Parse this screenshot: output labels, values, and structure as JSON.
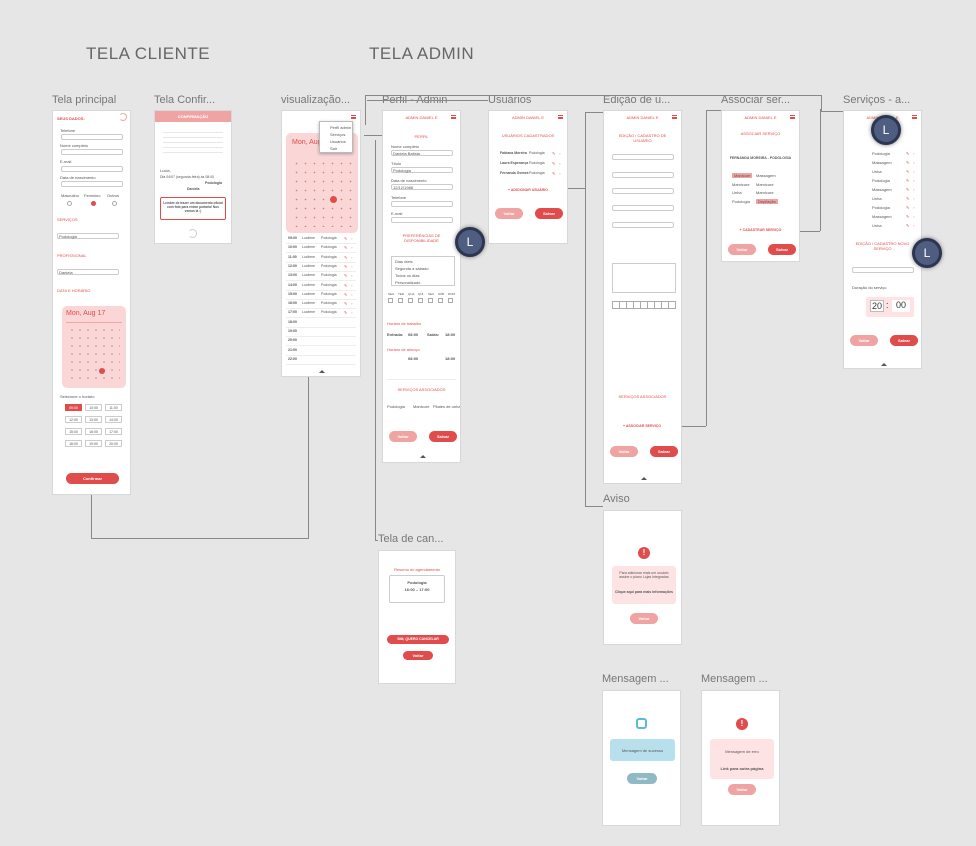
{
  "sections": {
    "client": "TELA CLIENTE",
    "admin": "TELA ADMIN"
  },
  "frames": {
    "principal": "Tela principal",
    "confirm": "Tela Confir...",
    "visual": "visualização...",
    "perfil": "Perfil - Admin",
    "usuarios": "Usuários",
    "edicao": "Edição de u...",
    "associar": "Associar ser...",
    "servicos": "Serviços - a...",
    "cancel": "Tela de can...",
    "aviso": "Aviso",
    "msg1": "Mensagem ...",
    "msg2": "Mensagem ..."
  },
  "avatar_letter": "L",
  "principal": {
    "header": "SEUS DADOS:",
    "telefone": "Telefone",
    "nome": "Nome completo",
    "email": "E-mail",
    "nascimento": "Data de nascimento",
    "genero": [
      "Masculino",
      "Feminino",
      "Outros"
    ],
    "servicos": "SERVIÇOS",
    "servico_sel": "Podologia",
    "profissional": "PROFISSIONAL",
    "prof_sel": "Daniela",
    "data_hora": "DATA E HORÁRIO",
    "cal_title": "Mon, Aug 17",
    "confirmar": "Confirmar",
    "times": [
      "09:00",
      "10:00",
      "11:00",
      "12:00",
      "13:00",
      "14:00",
      "15:00",
      "16:00",
      "17:00",
      "18:00",
      "19:00",
      "20:00"
    ]
  },
  "confirm": {
    "header": "CONFIRMAÇÃO",
    "text": "Lúcia,",
    "date": "Dia 04/07 (segunda-feira) às 08:00",
    "service": "Podologia",
    "prof": "Daniela",
    "note": "Lembre de trazer um documento oficial com foto para entrar portaria! Nos vemos lá :)"
  },
  "visual": {
    "month": "Mon, Aug 17",
    "agenda": [
      {
        "time": "09:00",
        "name": "Lucilene",
        "svc": "Podologia"
      },
      {
        "time": "10:00",
        "name": "Lucilene",
        "svc": "Podologia"
      },
      {
        "time": "11:00",
        "name": "Lucilene",
        "svc": "Podologia"
      },
      {
        "time": "12:00",
        "name": "Lucilene",
        "svc": "Podologia"
      },
      {
        "time": "13:00",
        "name": "Lucilene",
        "svc": "Podologia"
      },
      {
        "time": "14:00",
        "name": "Lucilene",
        "svc": "Podologia"
      },
      {
        "time": "15:00",
        "name": "Lucilene",
        "svc": "Podologia"
      },
      {
        "time": "16:00",
        "name": "Lucilene",
        "svc": "Podologia"
      },
      {
        "time": "17:00",
        "name": "Lucilene",
        "svc": "Podologia"
      },
      {
        "time": "18:00",
        "name": "",
        "svc": ""
      },
      {
        "time": "19:00",
        "name": "",
        "svc": ""
      },
      {
        "time": "20:00",
        "name": "",
        "svc": ""
      },
      {
        "time": "21:00",
        "name": "",
        "svc": ""
      },
      {
        "time": "22:00",
        "name": "",
        "svc": ""
      }
    ],
    "menu": [
      "Perfil admin",
      "Serviços",
      "Usuários",
      "Sair"
    ]
  },
  "perfil": {
    "header": "ADMIN DANIEL E",
    "title": "PERFIL",
    "nome": "Nome completo",
    "nome_val": "Daniela Batista",
    "titulo": "Título",
    "titulo_val": "Podologia",
    "nascimento": "Data de nascimento",
    "nasc_val": "12/12/1988",
    "telefone": "Telefone",
    "email": "E-mail",
    "pref": "PREFERÊNCIAS DE DISPONIBILIDADE",
    "opts": [
      "Dias úteis",
      "Segunda a sábado",
      "Todos os dias",
      "Personalizado"
    ],
    "days": [
      "SEG",
      "TER",
      "QUA",
      "QUI",
      "SEX",
      "SÁB",
      "DOM"
    ],
    "horario": "Horário de trabalho",
    "entrada": "Entrada:",
    "saida": "Saída:",
    "t1": "08:00",
    "t2": "18:00",
    "almoco": "Horário de almoço",
    "t3": "08:00",
    "t4": "18:00",
    "svc_title": "SERVIÇOS ASSOCIADOS",
    "svcs": [
      "Podologia",
      "Manicure",
      "Pilates de unha"
    ],
    "voltar": "Voltar",
    "salvar": "Salvar"
  },
  "usuarios": {
    "header": "ADMIN DANIEL E",
    "title": "USUÁRIOS CADASTRADOS",
    "list": [
      {
        "name": "Fabiana Moreira",
        "role": "Podologia"
      },
      {
        "name": "Laura Esperança",
        "role": "Podologia"
      },
      {
        "name": "Fernanda Gomes",
        "role": "Podologia"
      }
    ],
    "add": "+ ADICIONAR USUÁRIO",
    "voltar": "Voltar",
    "salvar": "Salvar"
  },
  "edicao": {
    "header": "ADMIN DANIEL E",
    "title": "EDIÇÃO / CADASTRO DE USUÁRIO",
    "add": "+ ASSOCIAR SERVIÇO",
    "svc_title": "SERVIÇOS ASSOCIADOS",
    "voltar": "Voltar",
    "salvar": "Salvar"
  },
  "associar": {
    "header": "ADMIN DANIEL E",
    "title": "ASSOCIAR SERVIÇO",
    "person": "FERNANDA MOREIRA - PODOLOGIA",
    "left": [
      "Manicure",
      "Mamicure",
      "Unha",
      "Podologia"
    ],
    "right": [
      "Massagem",
      "Mamicure",
      "Mamicure",
      "Depilação"
    ],
    "add": "+ CADASTRAR SERVIÇO",
    "voltar": "Voltar",
    "salvar": "Salvar"
  },
  "servicos": {
    "header": "ADMIN DANIEL E",
    "items": [
      "Podologia",
      "Massagem",
      "Unha",
      "Podologia",
      "Massagem",
      "Unha",
      "Podologia",
      "Massagem",
      "Unha"
    ],
    "form_title": "EDIÇÃO / CADASTRO NOVO SERVIÇO",
    "duracao": "Duração do serviço",
    "hh": "20",
    "mm": "00",
    "voltar": "Voltar",
    "salvar": "Salvar"
  },
  "cancel": {
    "title": "Resumo do agendamento",
    "svc": "Podologia",
    "time": "16:00 – 17:00",
    "btn": "SIM, QUERO CANCELAR",
    "voltar": "Voltar"
  },
  "aviso": {
    "text": "Para adicionar mais um usuário assine o plano Lojas Integradas",
    "link": "Clique aqui para mais informações",
    "btn": "Voltar"
  },
  "msg1": {
    "text": "Mensagem de sucesso",
    "btn": "Voltar"
  },
  "msg2": {
    "text": "Mensagem de erro",
    "link": "Link para outra página",
    "btn": "Voltar"
  }
}
